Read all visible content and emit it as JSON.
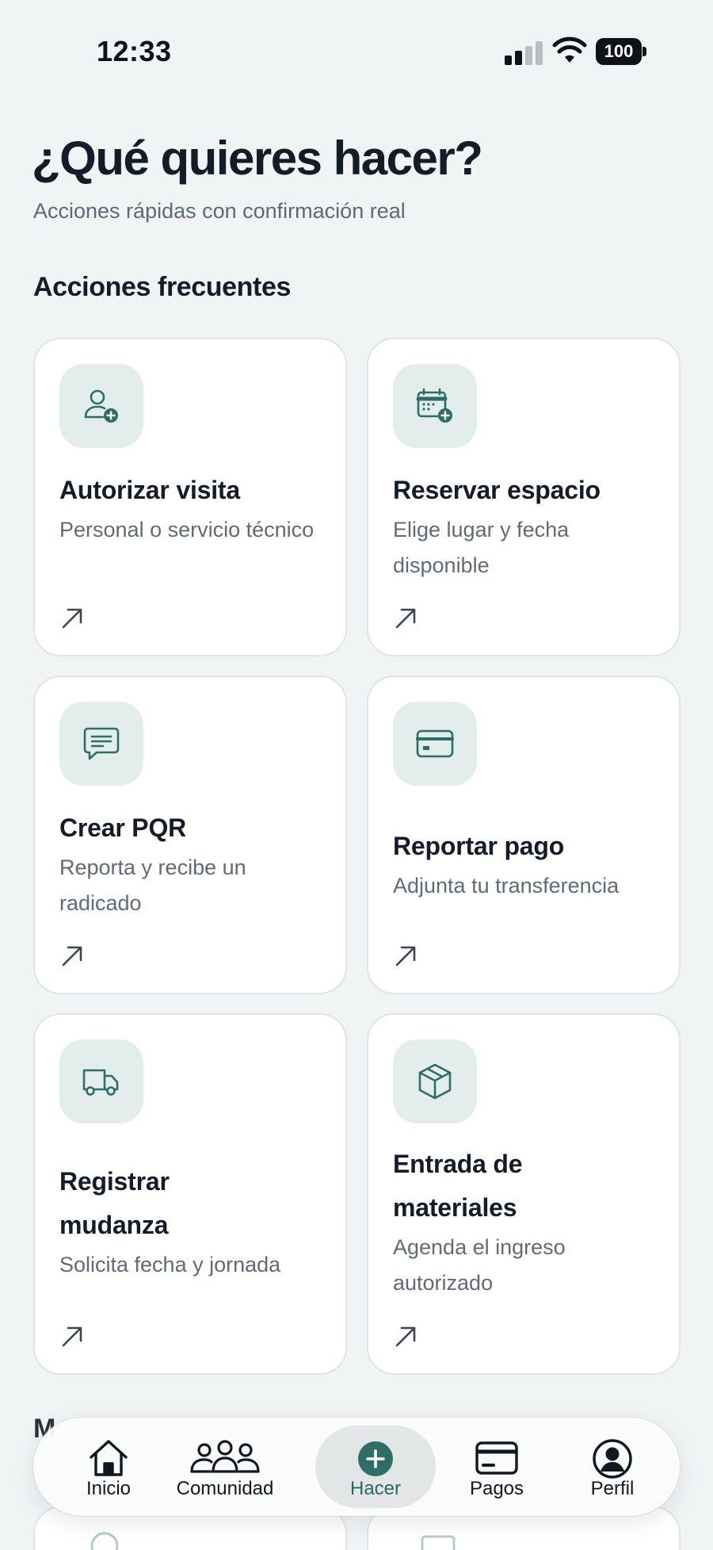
{
  "status_bar": {
    "time": "12:33",
    "battery": "100"
  },
  "header": {
    "title": "¿Qué quieres hacer?",
    "subtitle": "Acciones rápidas con confirmación real"
  },
  "frequent": {
    "section_title": "Acciones frecuentes",
    "cards": [
      {
        "title": "Autorizar visita",
        "description": "Personal o servicio técnico",
        "icon": "user-add-icon"
      },
      {
        "title": "Reservar espacio",
        "description": "Elige lugar y fecha disponible",
        "icon": "calendar-add-icon"
      },
      {
        "title": "Crear PQR",
        "description": "Reporta y recibe un radicado",
        "icon": "chat-icon"
      },
      {
        "title": "Reportar pago",
        "description": "Adjunta tu transferencia",
        "icon": "credit-card-icon"
      },
      {
        "title": "Registrar mudanza",
        "description": "Solicita fecha y jornada",
        "icon": "truck-icon"
      },
      {
        "title": "Entrada de materiales",
        "description": "Agenda el ingreso autorizado",
        "icon": "box-icon"
      }
    ]
  },
  "next_section": {
    "title": "M"
  },
  "tab_bar": {
    "tabs": [
      {
        "label": "Inicio",
        "icon": "home-icon"
      },
      {
        "label": "Comunidad",
        "icon": "community-icon"
      },
      {
        "label": "Hacer",
        "icon": "plus-circle-icon",
        "active": true
      },
      {
        "label": "Pagos",
        "icon": "card-icon"
      },
      {
        "label": "Perfil",
        "icon": "profile-icon"
      }
    ]
  },
  "colors": {
    "accent": "#2f6e66",
    "icon_bg": "#e3eeec",
    "background": "#f1f4f5",
    "text_primary": "#131c27",
    "text_secondary": "#5f6b76"
  }
}
